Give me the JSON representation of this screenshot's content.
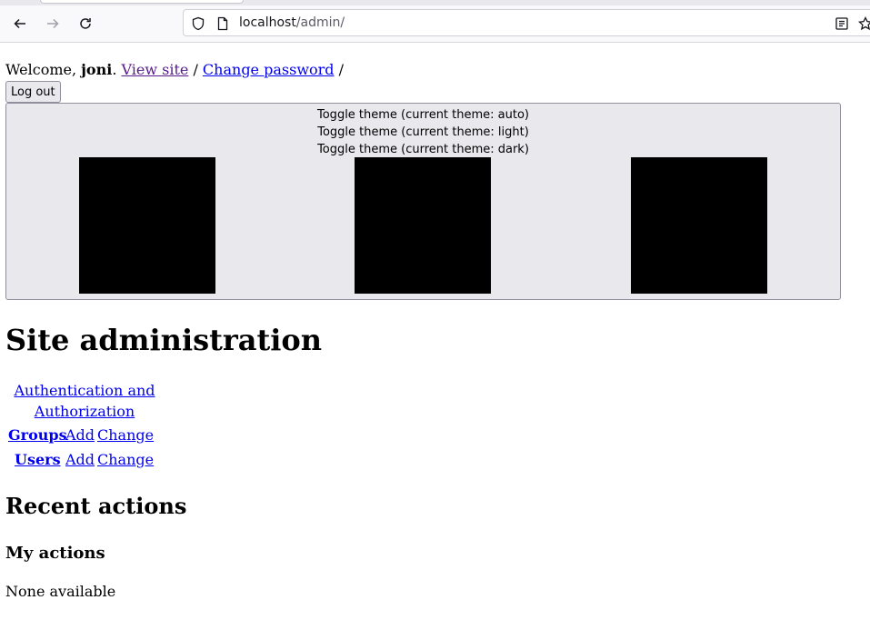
{
  "browser": {
    "url_host": "localhost",
    "url_path": "/admin/"
  },
  "user_tools": {
    "welcome": "Welcome, ",
    "username": "joni",
    "period": ". ",
    "view_site": "View site",
    "separator": " / ",
    "change_password": "Change password",
    "trailing": " /",
    "logout": "Log out"
  },
  "theme_toggle": {
    "lines": [
      "Toggle theme (current theme: auto)",
      "Toggle theme (current theme: light)",
      "Toggle theme (current theme: dark)"
    ]
  },
  "page_title": "Site administration",
  "app_module": {
    "caption": "Authentication and Authorization",
    "models": [
      {
        "name": "Groups",
        "add": "Add",
        "change": "Change"
      },
      {
        "name": "Users",
        "add": "Add",
        "change": "Change"
      }
    ]
  },
  "recent_actions": {
    "title": "Recent actions",
    "subtitle": "My actions",
    "empty": "None available"
  }
}
